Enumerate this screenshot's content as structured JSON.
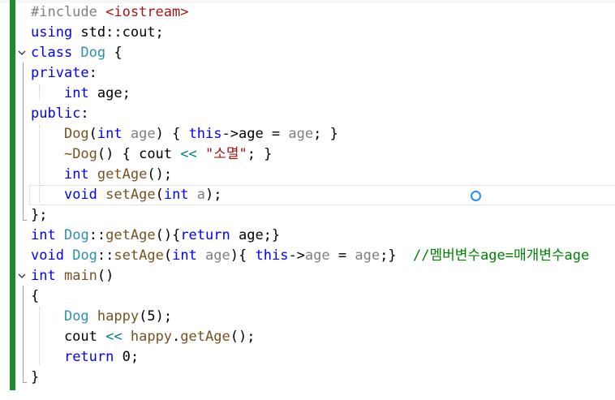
{
  "editor": {
    "lines": [
      [
        {
          "t": "#include ",
          "c": "pre"
        },
        {
          "t": "<iostream>",
          "c": "str"
        }
      ],
      [
        {
          "t": "using ",
          "c": "kw"
        },
        {
          "t": "std::cout;",
          "c": "mem"
        }
      ],
      [
        {
          "t": "class ",
          "c": "kw"
        },
        {
          "t": "Dog",
          "c": "ty"
        },
        {
          "t": " {",
          "c": "mem"
        }
      ],
      [
        {
          "t": "private",
          "c": "kw"
        },
        {
          "t": ":",
          "c": "mem"
        }
      ],
      [
        {
          "t": "    ",
          "c": "mem"
        },
        {
          "t": "int",
          "c": "kw"
        },
        {
          "t": " age;",
          "c": "mem"
        }
      ],
      [
        {
          "t": "public",
          "c": "kw"
        },
        {
          "t": ":",
          "c": "mem"
        }
      ],
      [
        {
          "t": "    ",
          "c": "mem"
        },
        {
          "t": "Dog",
          "c": "fn"
        },
        {
          "t": "(",
          "c": "mem"
        },
        {
          "t": "int",
          "c": "kw"
        },
        {
          "t": " ",
          "c": "mem"
        },
        {
          "t": "age",
          "c": "prm"
        },
        {
          "t": ") { ",
          "c": "mem"
        },
        {
          "t": "this",
          "c": "kw"
        },
        {
          "t": "->age = ",
          "c": "mem"
        },
        {
          "t": "age",
          "c": "prm"
        },
        {
          "t": "; }",
          "c": "mem"
        }
      ],
      [
        {
          "t": "    ",
          "c": "mem"
        },
        {
          "t": "~Dog",
          "c": "fn"
        },
        {
          "t": "() { cout ",
          "c": "mem"
        },
        {
          "t": "<<",
          "c": "op"
        },
        {
          "t": " ",
          "c": "mem"
        },
        {
          "t": "\"소멸\"",
          "c": "str"
        },
        {
          "t": "; }",
          "c": "mem"
        }
      ],
      [
        {
          "t": "    ",
          "c": "mem"
        },
        {
          "t": "int",
          "c": "kw"
        },
        {
          "t": " ",
          "c": "mem"
        },
        {
          "t": "getAge",
          "c": "fn"
        },
        {
          "t": "();",
          "c": "mem"
        }
      ],
      [
        {
          "t": "    ",
          "c": "mem"
        },
        {
          "t": "void",
          "c": "kw"
        },
        {
          "t": " ",
          "c": "mem"
        },
        {
          "t": "setAge",
          "c": "fn"
        },
        {
          "t": "(",
          "c": "mem"
        },
        {
          "t": "int",
          "c": "kw"
        },
        {
          "t": " ",
          "c": "mem"
        },
        {
          "t": "a",
          "c": "prm"
        },
        {
          "t": ");",
          "c": "mem"
        }
      ],
      [
        {
          "t": "};",
          "c": "mem"
        }
      ],
      [
        {
          "t": "int",
          "c": "kw"
        },
        {
          "t": " ",
          "c": "mem"
        },
        {
          "t": "Dog",
          "c": "ty"
        },
        {
          "t": "::",
          "c": "mem"
        },
        {
          "t": "getAge",
          "c": "fn"
        },
        {
          "t": "(){",
          "c": "mem"
        },
        {
          "t": "return",
          "c": "kw"
        },
        {
          "t": " age;}",
          "c": "mem"
        }
      ],
      [
        {
          "t": "void",
          "c": "kw"
        },
        {
          "t": " ",
          "c": "mem"
        },
        {
          "t": "Dog",
          "c": "ty"
        },
        {
          "t": "::",
          "c": "mem"
        },
        {
          "t": "setAge",
          "c": "fn"
        },
        {
          "t": "(",
          "c": "mem"
        },
        {
          "t": "int",
          "c": "kw"
        },
        {
          "t": " ",
          "c": "mem"
        },
        {
          "t": "age",
          "c": "prm"
        },
        {
          "t": "){ ",
          "c": "mem"
        },
        {
          "t": "this",
          "c": "kw"
        },
        {
          "t": "->",
          "c": "mem"
        },
        {
          "t": "age",
          "c": "prm"
        },
        {
          "t": " = ",
          "c": "mem"
        },
        {
          "t": "age",
          "c": "prm"
        },
        {
          "t": ";}  ",
          "c": "mem"
        },
        {
          "t": "//멤버변수age=매개변수age",
          "c": "cm"
        }
      ],
      [
        {
          "t": "int",
          "c": "kw"
        },
        {
          "t": " ",
          "c": "mem"
        },
        {
          "t": "main",
          "c": "fn"
        },
        {
          "t": "()",
          "c": "mem"
        }
      ],
      [
        {
          "t": "{",
          "c": "mem"
        }
      ],
      [
        {
          "t": "    ",
          "c": "mem"
        },
        {
          "t": "Dog",
          "c": "ty"
        },
        {
          "t": " ",
          "c": "mem"
        },
        {
          "t": "happy",
          "c": "fn"
        },
        {
          "t": "(5);",
          "c": "mem"
        }
      ],
      [
        {
          "t": "    cout ",
          "c": "mem"
        },
        {
          "t": "<<",
          "c": "op"
        },
        {
          "t": " ",
          "c": "mem"
        },
        {
          "t": "happy",
          "c": "fn"
        },
        {
          "t": ".",
          "c": "mem"
        },
        {
          "t": "getAge",
          "c": "fn"
        },
        {
          "t": "();",
          "c": "mem"
        }
      ],
      [
        {
          "t": "    ",
          "c": "mem"
        },
        {
          "t": "return",
          "c": "kw"
        },
        {
          "t": " 0;",
          "c": "mem"
        }
      ],
      [
        {
          "t": "}",
          "c": "mem"
        }
      ]
    ],
    "fold_icon": "chevron-down-icon",
    "cursor_icon": "cursor-ring-icon",
    "colors": {
      "keyword": "#0000ff",
      "type": "#2b91af",
      "function": "#74531f",
      "string": "#a31515",
      "comment": "#008000",
      "preprocessor": "#808080",
      "parameter": "#808080",
      "operator": "#008080",
      "change_bar": "#1f8a2c"
    }
  }
}
